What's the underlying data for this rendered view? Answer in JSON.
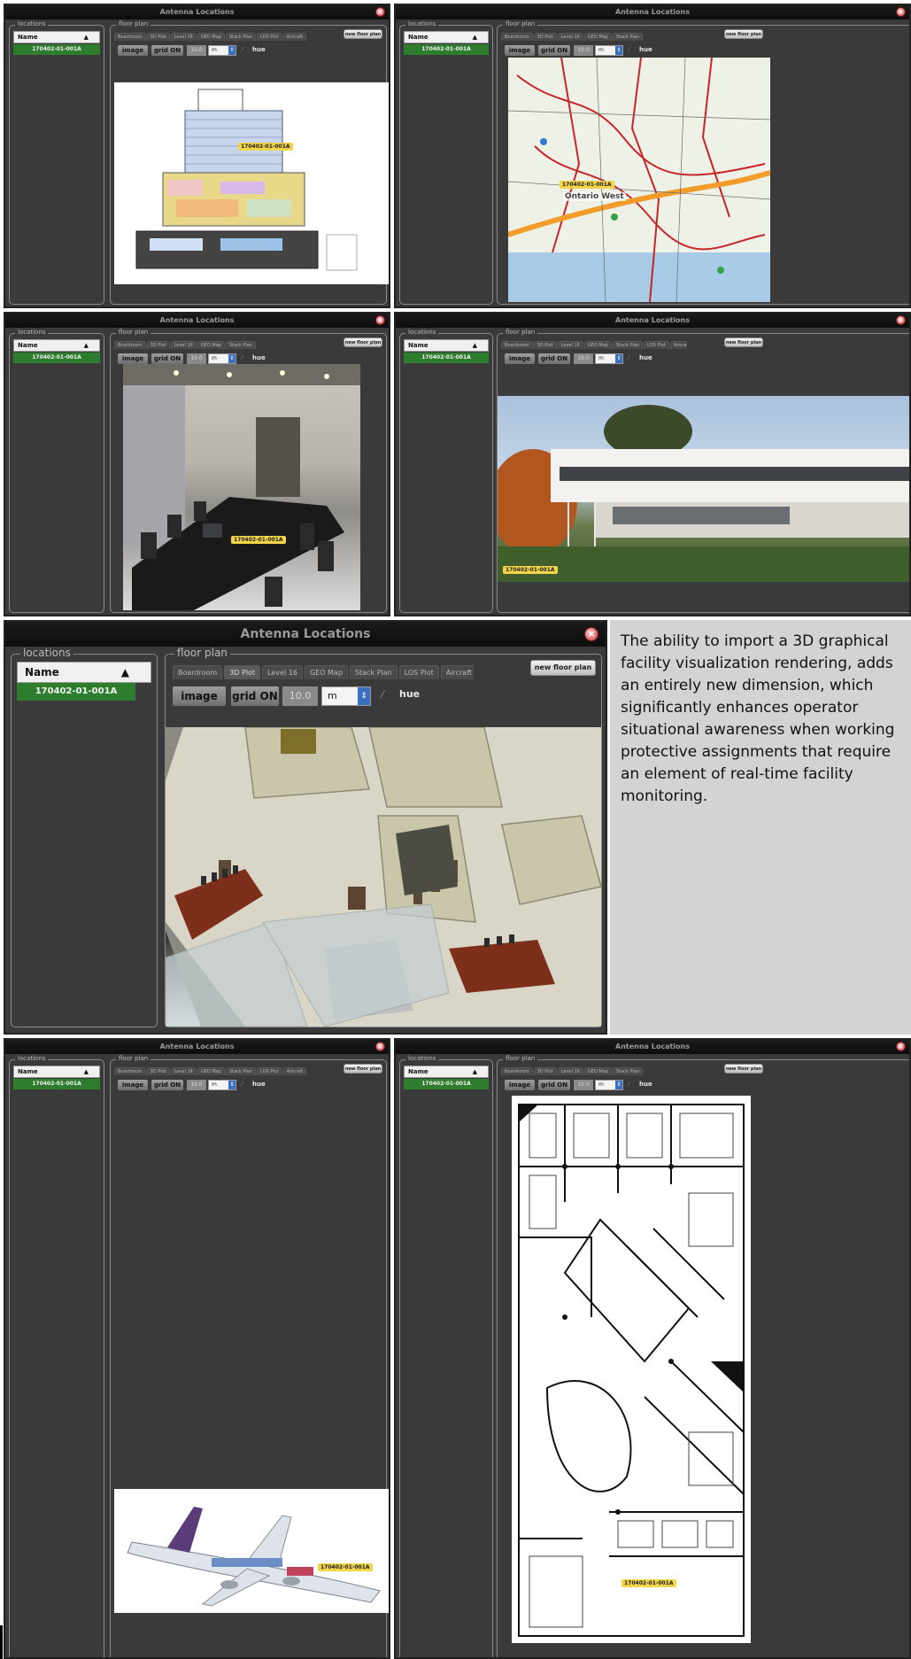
{
  "app": {
    "title": "Antenna Locations",
    "close_glyph": "×"
  },
  "panel": {
    "locations_label": "locations",
    "list_header": "Name",
    "sort_glyph": "▲",
    "location_id": "170402-01-001A",
    "floorplan_label": "floor plan",
    "new_floor_plan": "new floor plan",
    "image_button": "image",
    "grid_button": "grid ON",
    "grid_value": "10.0",
    "unit": "m",
    "unit_arrow": "⇕",
    "pin_glyph": "⁄",
    "field_value": "hue"
  },
  "tabs_main": [
    "Boardroom",
    "3D Plot",
    "Level 16",
    "GEO Map",
    "Stack Plan",
    "LOS Plot",
    "Aircraft"
  ],
  "tabs_small": [
    "Boardroom",
    "3D Plot",
    "Level 16",
    "GEO Map",
    "Stack Plan",
    "LOS Plot",
    "Aircraft"
  ],
  "map_label": "Ontario West",
  "description": "The ability to import a 3D graphical facility visualization rendering, adds an entirely new dimension, which significantly enhances operator situational awareness when working protective assignments that require an element of real-time facility monitoring."
}
